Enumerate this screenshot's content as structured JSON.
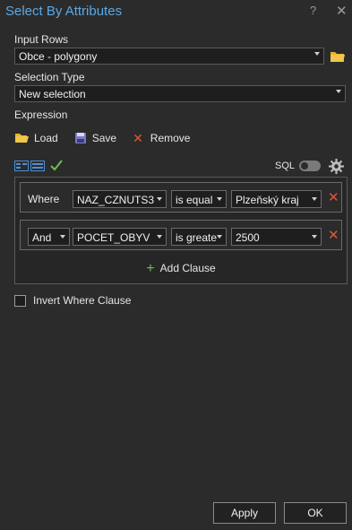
{
  "window": {
    "title": "Select By Attributes",
    "help_label": "?",
    "close_label": "✕"
  },
  "input_rows": {
    "label": "Input Rows",
    "value": "Obce - polygony"
  },
  "selection_type": {
    "label": "Selection Type",
    "value": "New selection"
  },
  "expression": {
    "label": "Expression",
    "load_label": "Load",
    "save_label": "Save",
    "remove_label": "Remove",
    "sql_label": "SQL",
    "sql_enabled": false,
    "clauses": [
      {
        "connector": "Where",
        "field": "NAZ_CZNUTS3",
        "operator": "is equal",
        "value": "Plzeňský kraj"
      },
      {
        "connector": "And",
        "field": "POCET_OBYV",
        "operator": "is greate",
        "value": "2500"
      }
    ],
    "add_clause_label": "Add Clause"
  },
  "invert_where": {
    "label": "Invert Where Clause",
    "checked": false
  },
  "buttons": {
    "apply": "Apply",
    "ok": "OK"
  },
  "colors": {
    "title": "#5aa9e6",
    "accent_green": "#6fbf4a",
    "delete_red": "#e2553a",
    "folder_yellow": "#e8b530",
    "save_purple": "#7b78c9"
  }
}
